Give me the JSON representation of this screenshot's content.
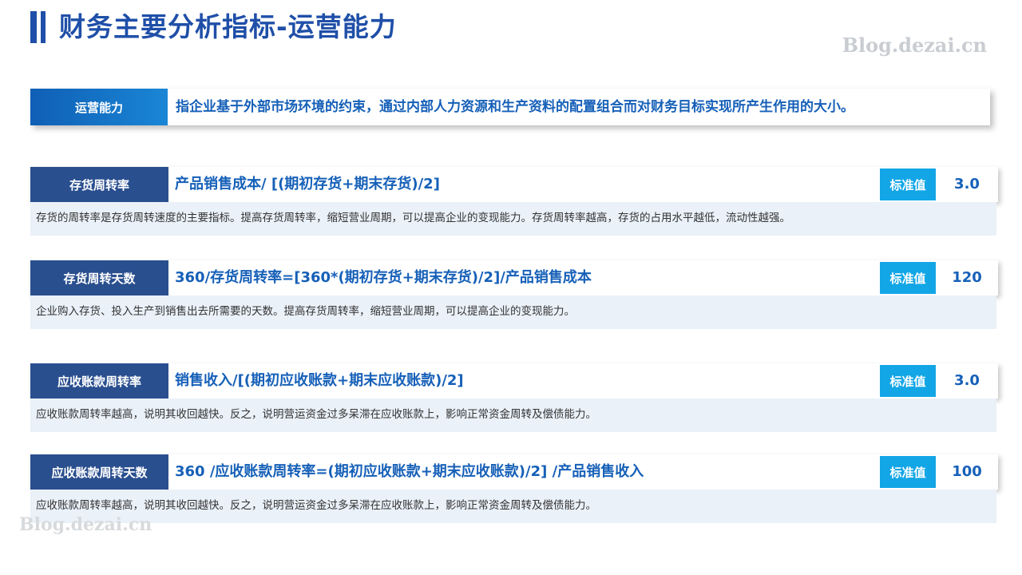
{
  "title": "财务主要分析指标-运营能力",
  "watermark": "Blog.dezai.cn",
  "definition": {
    "label": "运营能力",
    "text": "指企业基于外部市场环境的约束，通过内部人力资源和生产资料的配置组合而对财务目标实现所产生作用的大小。"
  },
  "standard_label": "标准值",
  "metrics": [
    {
      "label": "存货周转率",
      "formula": "产品销售成本/ [(期初存货+期末存货)/2]",
      "value": "3.0",
      "description": "存货的周转率是存货周转速度的主要指标。提高存货周转率，缩短营业周期，可以提高企业的变现能力。存货周转率越高，存货的占用水平越低，流动性越强。"
    },
    {
      "label": "存货周转天数",
      "formula": "360/存货周转率=[360*(期初存货+期末存货)/2]/产品销售成本",
      "value": "120",
      "description": "企业购入存货、投入生产到销售出去所需要的天数。提高存货周转率，缩短营业周期，可以提高企业的变现能力。"
    },
    {
      "label": "应收账款周转率",
      "formula": "销售收入/[(期初应收账款+期末应收账款)/2]",
      "value": "3.0",
      "description": "应收账款周转率越高，说明其收回越快。反之，说明营运资金过多呆滞在应收账款上，影响正常资金周转及偿债能力。"
    },
    {
      "label": "应收账款周转天数",
      "formula": "360 /应收账款周转率=(期初应收账款+期末应收账款)/2] /产品销售收入",
      "value": "100",
      "description": "应收账款周转率越高，说明其收回越快。反之，说明营运资金过多呆滞在应收账款上，影响正常资金周转及偿债能力。"
    }
  ]
}
